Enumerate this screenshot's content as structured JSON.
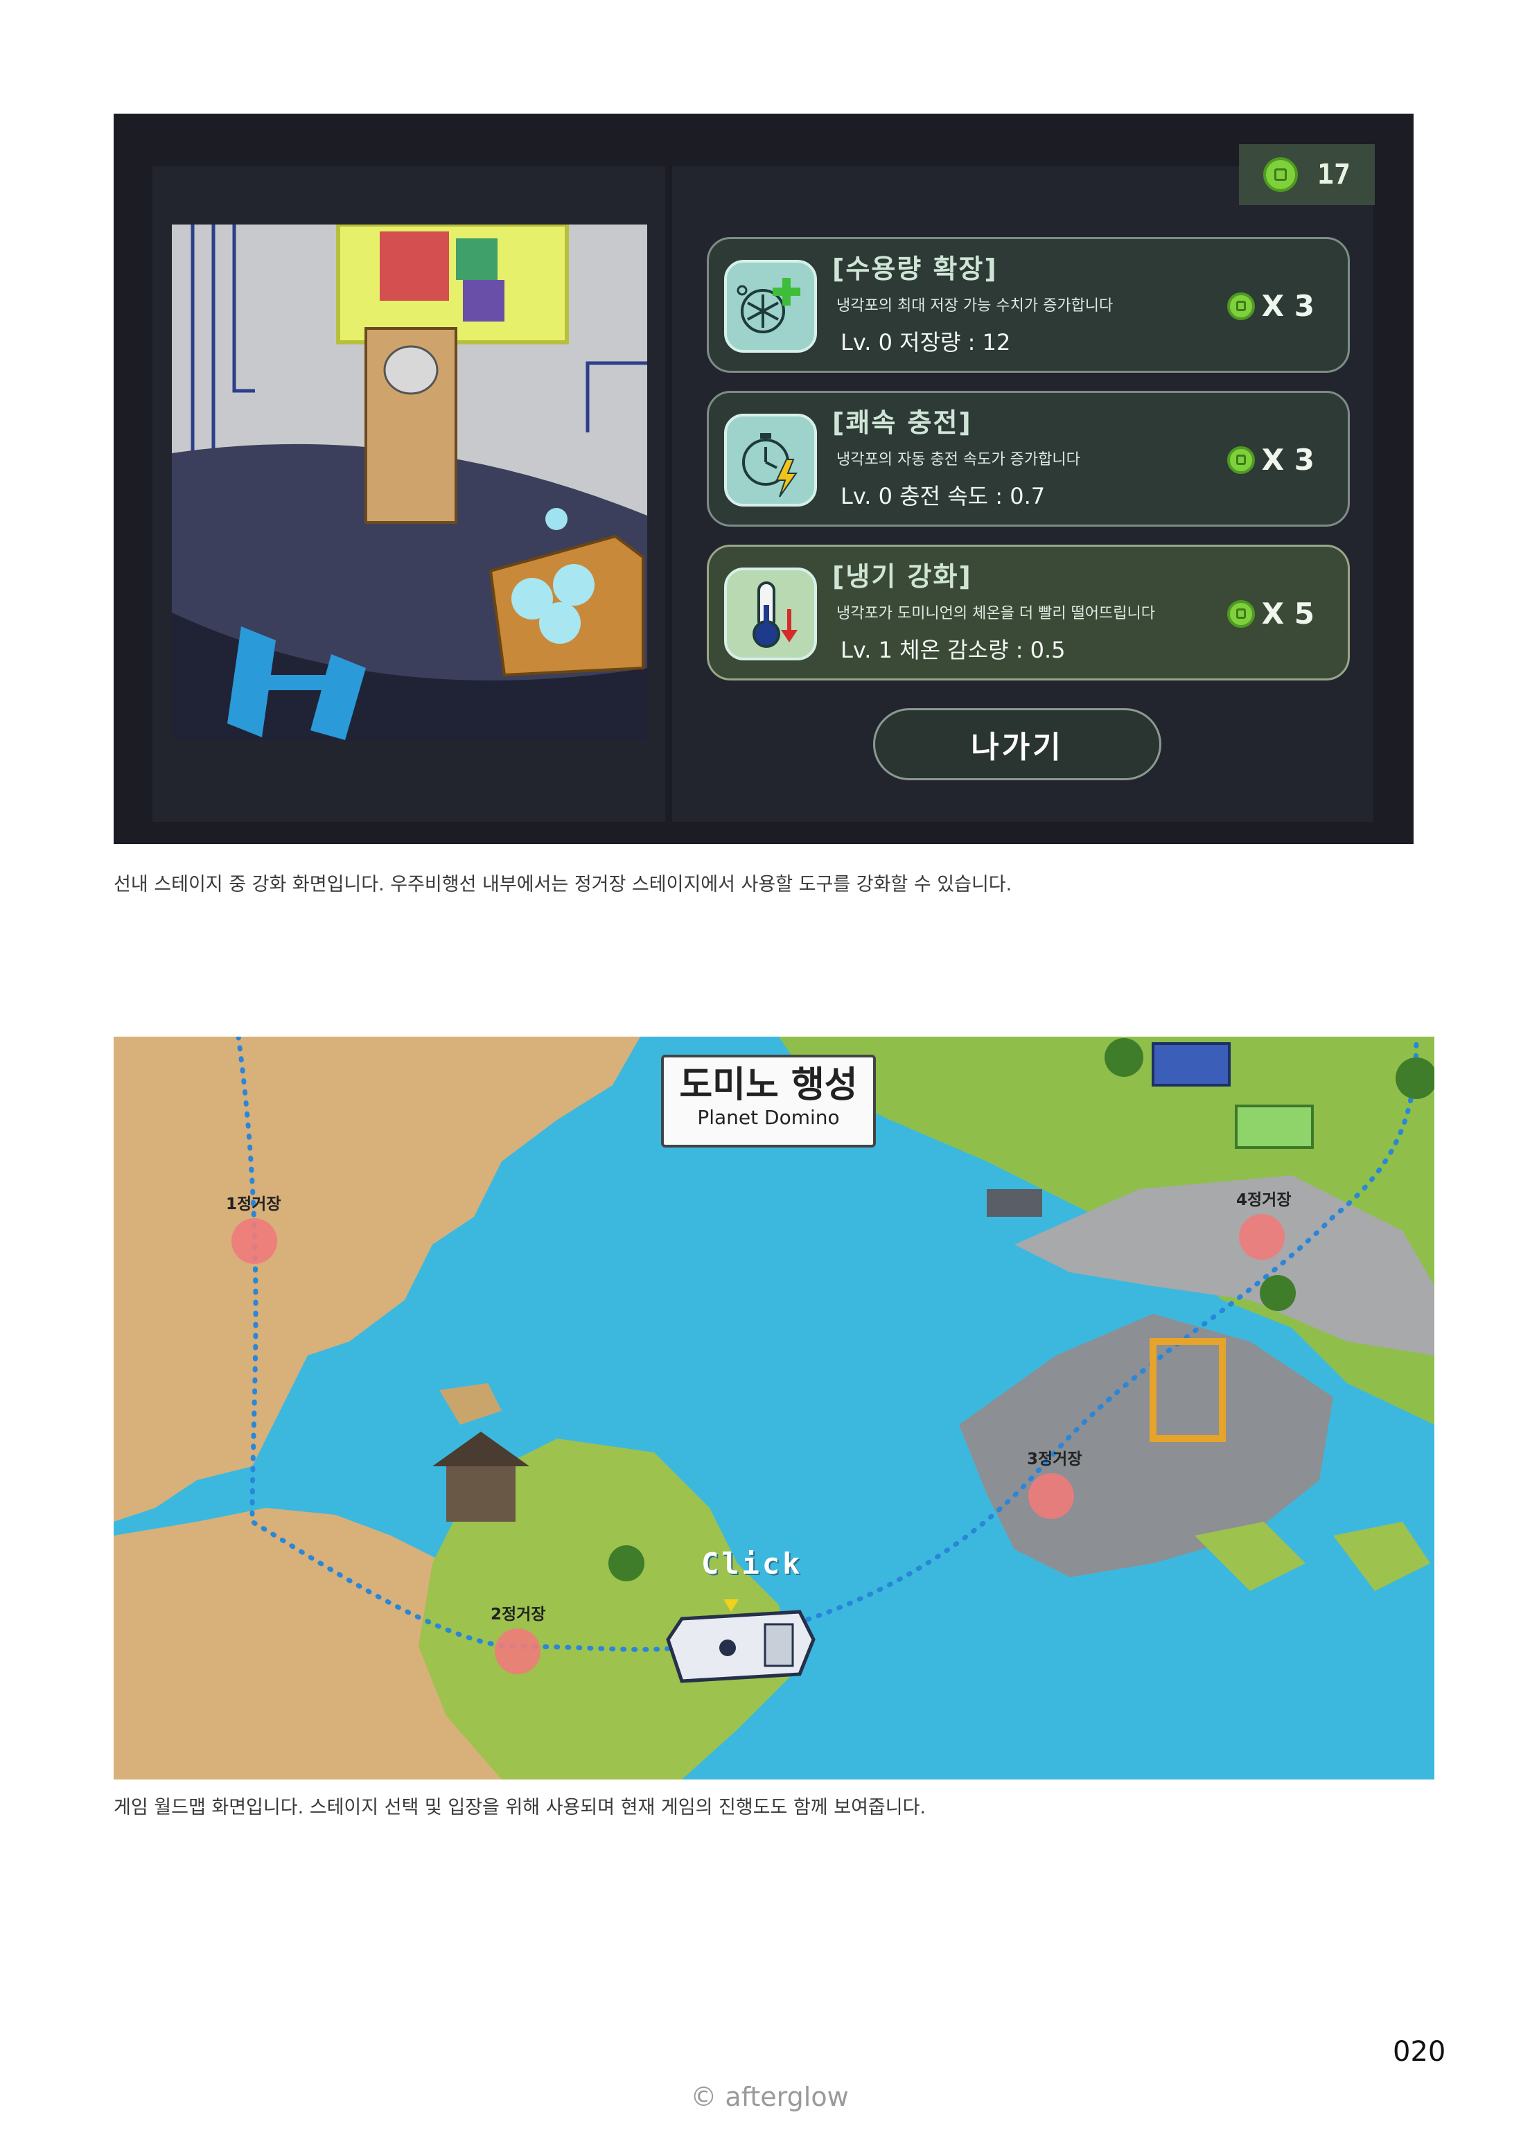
{
  "upgrade_screen": {
    "coins": "17",
    "cards": [
      {
        "title": "[수용량 확장]",
        "description": "냉각포의 최대 저장 가능 수치가 증가합니다",
        "level": "Lv. 0 저장량 : 12",
        "cost": "X 3",
        "icon": "snowflake-plus-icon"
      },
      {
        "title": "[쾌속 충전]",
        "description": "냉각포의 자동 충전 속도가 증가합니다",
        "level": "Lv. 0 충전 속도 : 0.7",
        "cost": "X 3",
        "icon": "stopwatch-bolt-icon"
      },
      {
        "title": "[냉기 강화]",
        "description": "냉각포가 도미니언의 체온을 더 빨리 떨어뜨립니다",
        "level": "Lv. 1 체온 감소량 : 0.5",
        "cost": "X 5",
        "icon": "thermometer-down-icon"
      }
    ],
    "exit_label": "나가기"
  },
  "caption_1": "선내 스테이지 중 강화 화면입니다. 우주비행선 내부에서는 정거장 스테이지에서 사용할 도구를 강화할 수 있습니다.",
  "world_map": {
    "title_kr": "도미노 행성",
    "title_en": "Planet Domino",
    "stages": [
      "1정거장",
      "2정거장",
      "3정거장",
      "4정거장"
    ],
    "click_label": "Click"
  },
  "caption_2": "게임 월드맵 화면입니다. 스테이지 선택 및 입장을 위해 사용되며 현재 게임의 진행도도 함께 보여줍니다.",
  "page_number": "020",
  "footer": "© afterglow",
  "colors": {
    "coin": "#7fd13b",
    "panel": "#23252e",
    "sea": "#3cb8df",
    "stage": "#ef7b7b"
  }
}
